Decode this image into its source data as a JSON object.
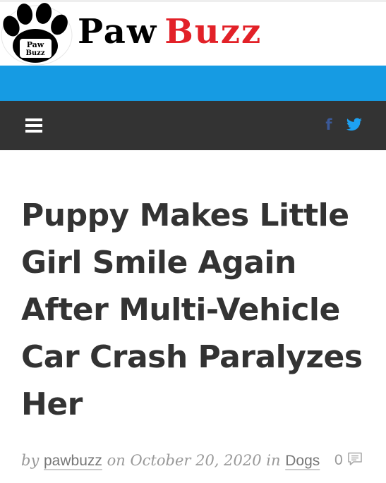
{
  "site": {
    "logo_badge_line1": "Paw",
    "logo_badge_line2": "Buzz",
    "wordmark_part1": "Paw",
    "wordmark_part2": "Buzz"
  },
  "colors": {
    "brand_red": "#e22128",
    "band_blue": "#169be3",
    "nav_dark": "#333333",
    "facebook": "#3b5998",
    "twitter": "#1da1f2"
  },
  "nav": {
    "menu_icon": "hamburger-menu-icon",
    "social_icons": [
      "facebook-icon",
      "twitter-icon"
    ],
    "facebook_glyph": "f"
  },
  "article": {
    "title": "Puppy Makes Little Girl Smile Again After Multi-Vehicle Car Crash Paralyzes Her",
    "by_prefix": "by",
    "author": "pawbuzz",
    "on_prefix": "on",
    "date": "October 20, 2020",
    "in_prefix": "in",
    "category": "Dogs",
    "comment_count": "0",
    "comment_icon": "comment-bubble-icon"
  }
}
